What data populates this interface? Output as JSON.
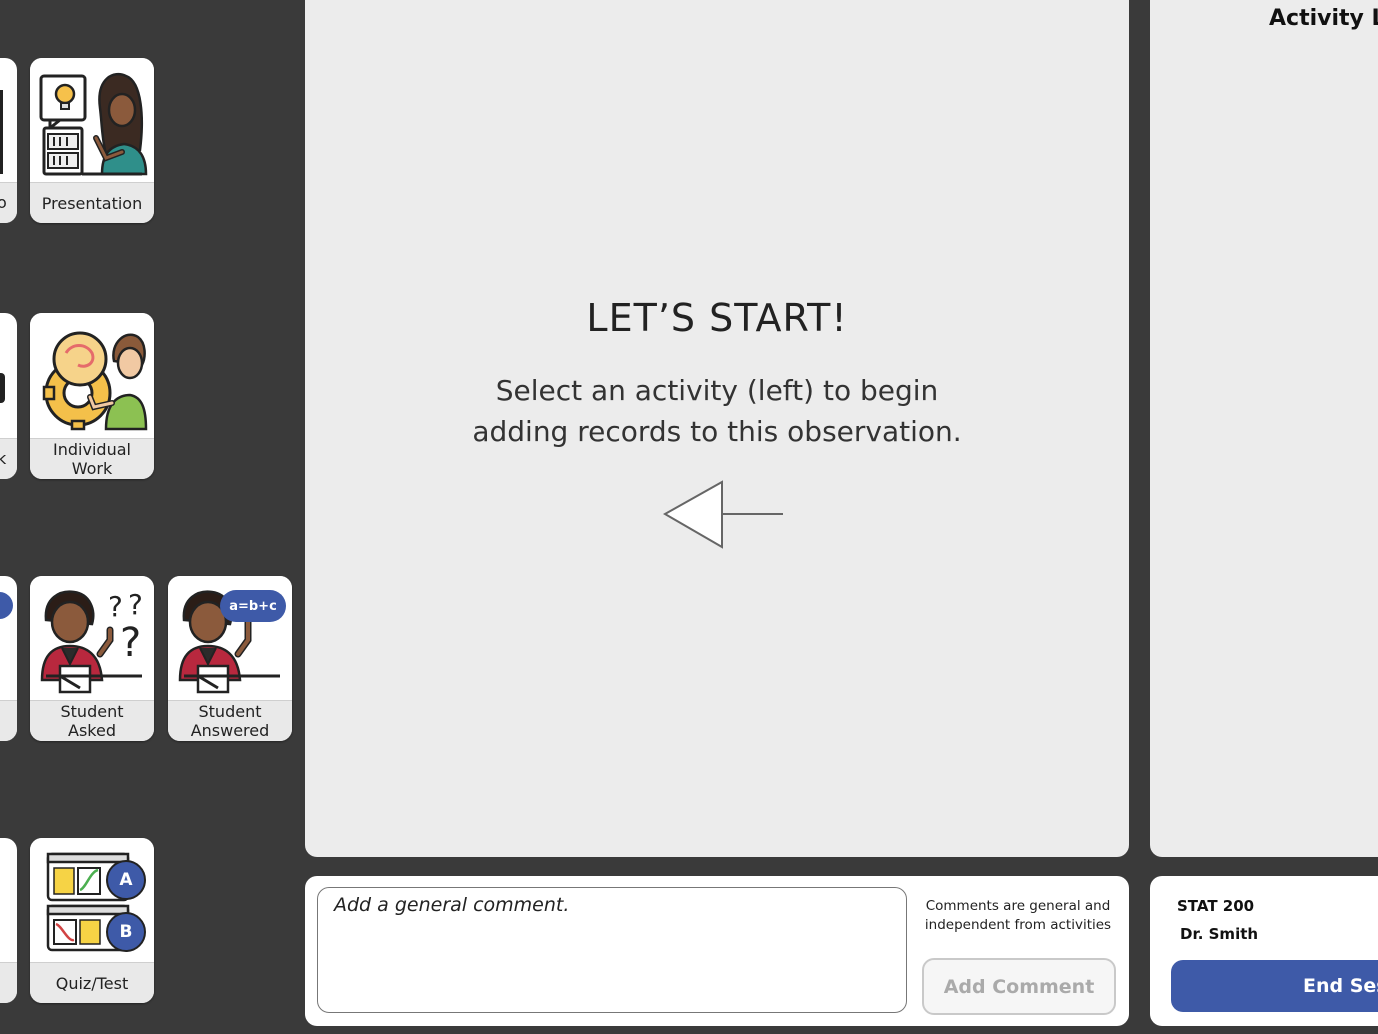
{
  "activity_cards": [
    {
      "label": "Presentation",
      "icon": "presentation-icon"
    },
    {
      "label": "Individual\nWork",
      "icon": "individual-work-icon"
    },
    {
      "label": "Student\nAsked",
      "icon": "student-asked-icon"
    },
    {
      "label": "Student\nAnswered",
      "icon": "student-answered-icon",
      "badge": "a=b+c"
    },
    {
      "label": "Quiz/Test",
      "icon": "quiz-test-icon",
      "option_a": "A",
      "option_b": "B"
    }
  ],
  "partial_cards": {
    "row1_label": "o",
    "row2_label": "k"
  },
  "main": {
    "title": "LET’S START!",
    "subtitle_line1": "Select an activity (left) to begin",
    "subtitle_line2": "adding records to this observation."
  },
  "comment": {
    "placeholder": "Add a general comment.",
    "note": "Comments are general and independent from activities",
    "button_label": "Add Comment"
  },
  "session": {
    "course": "STAT 200",
    "instructor": "Dr. Smith",
    "end_label": "End Session"
  },
  "activity_log": {
    "title": "Activity Log"
  },
  "colors": {
    "background": "#3a3a3a",
    "panel": "#ececec",
    "accent_blue": "#3e5aa8",
    "student_shirt": "#b8283e"
  }
}
